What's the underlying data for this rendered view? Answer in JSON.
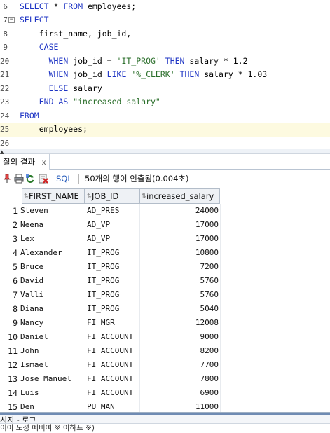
{
  "editor": {
    "lines": [
      {
        "num": "6",
        "fold": "",
        "current": false,
        "indent": 0,
        "tokens": [
          {
            "t": "SELECT",
            "k": "kw"
          },
          {
            "t": " * ",
            "k": ""
          },
          {
            "t": "FROM",
            "k": "kw"
          },
          {
            "t": " employees;",
            "k": ""
          }
        ]
      },
      {
        "num": "7",
        "fold": "−",
        "current": false,
        "indent": 0,
        "tokens": [
          {
            "t": "SELECT",
            "k": "kw"
          }
        ]
      },
      {
        "num": "8",
        "fold": "",
        "current": false,
        "indent": 4,
        "tokens": [
          {
            "t": "first_name, job_id,",
            "k": ""
          }
        ]
      },
      {
        "num": "9",
        "fold": "",
        "current": false,
        "indent": 4,
        "tokens": [
          {
            "t": "CASE",
            "k": "kw"
          }
        ]
      },
      {
        "num": "20",
        "fold": "",
        "current": false,
        "indent": 6,
        "tokens": [
          {
            "t": "WHEN",
            "k": "kw"
          },
          {
            "t": " job_id = ",
            "k": ""
          },
          {
            "t": "'IT_PROG'",
            "k": "str"
          },
          {
            "t": " ",
            "k": ""
          },
          {
            "t": "THEN",
            "k": "kw"
          },
          {
            "t": " salary * 1.2",
            "k": ""
          }
        ]
      },
      {
        "num": "21",
        "fold": "",
        "current": false,
        "indent": 6,
        "tokens": [
          {
            "t": "WHEN",
            "k": "kw"
          },
          {
            "t": " job_id ",
            "k": ""
          },
          {
            "t": "LIKE",
            "k": "kw"
          },
          {
            "t": " ",
            "k": ""
          },
          {
            "t": "'%_CLERK'",
            "k": "str"
          },
          {
            "t": " ",
            "k": ""
          },
          {
            "t": "THEN",
            "k": "kw"
          },
          {
            "t": " salary * 1.03",
            "k": ""
          }
        ]
      },
      {
        "num": "22",
        "fold": "",
        "current": false,
        "indent": 6,
        "tokens": [
          {
            "t": "ELSE",
            "k": "kw"
          },
          {
            "t": " salary",
            "k": ""
          }
        ]
      },
      {
        "num": "23",
        "fold": "",
        "current": false,
        "indent": 4,
        "tokens": [
          {
            "t": "END AS",
            "k": "kw"
          },
          {
            "t": " ",
            "k": ""
          },
          {
            "t": "\"increased_salary\"",
            "k": "str"
          }
        ]
      },
      {
        "num": "24",
        "fold": "",
        "current": false,
        "indent": 0,
        "tokens": [
          {
            "t": "FROM",
            "k": "kw"
          }
        ]
      },
      {
        "num": "25",
        "fold": "",
        "current": true,
        "indent": 4,
        "caret": true,
        "tokens": [
          {
            "t": "employees;",
            "k": ""
          }
        ]
      },
      {
        "num": "26",
        "fold": "",
        "current": false,
        "indent": 0,
        "tokens": []
      }
    ]
  },
  "results_tab": {
    "label": "질의 결과",
    "close": "x"
  },
  "toolbar": {
    "icons": [
      "pin-icon",
      "print-icon",
      "refresh-icon",
      "delete-icon"
    ],
    "sql_label": "SQL",
    "separator": "|",
    "status": "50개의 행이 인출됨(0.004초)"
  },
  "grid": {
    "columns": [
      "FIRST_NAME",
      "JOB_ID",
      "increased_salary"
    ],
    "rows": [
      {
        "n": "1",
        "first_name": "Steven",
        "job_id": "AD_PRES",
        "salary": "24000"
      },
      {
        "n": "2",
        "first_name": "Neena",
        "job_id": "AD_VP",
        "salary": "17000"
      },
      {
        "n": "3",
        "first_name": "Lex",
        "job_id": "AD_VP",
        "salary": "17000"
      },
      {
        "n": "4",
        "first_name": "Alexander",
        "job_id": "IT_PROG",
        "salary": "10800"
      },
      {
        "n": "5",
        "first_name": "Bruce",
        "job_id": "IT_PROG",
        "salary": "7200"
      },
      {
        "n": "6",
        "first_name": "David",
        "job_id": "IT_PROG",
        "salary": "5760"
      },
      {
        "n": "7",
        "first_name": "Valli",
        "job_id": "IT_PROG",
        "salary": "5760"
      },
      {
        "n": "8",
        "first_name": "Diana",
        "job_id": "IT_PROG",
        "salary": "5040"
      },
      {
        "n": "9",
        "first_name": "Nancy",
        "job_id": "FI_MGR",
        "salary": "12008"
      },
      {
        "n": "10",
        "first_name": "Daniel",
        "job_id": "FI_ACCOUNT",
        "salary": "9000"
      },
      {
        "n": "11",
        "first_name": "John",
        "job_id": "FI_ACCOUNT",
        "salary": "8200"
      },
      {
        "n": "12",
        "first_name": "Ismael",
        "job_id": "FI_ACCOUNT",
        "salary": "7700"
      },
      {
        "n": "13",
        "first_name": "Jose Manuel",
        "job_id": "FI_ACCOUNT",
        "salary": "7800"
      },
      {
        "n": "14",
        "first_name": "Luis",
        "job_id": "FI_ACCOUNT",
        "salary": "6900"
      },
      {
        "n": "15",
        "first_name": "Den",
        "job_id": "PU_MAN",
        "salary": "11000"
      }
    ]
  },
  "log_panel": {
    "title": "시지 - 로그",
    "text": "이이    노성 예비여 ※ 이하프 ※)"
  }
}
